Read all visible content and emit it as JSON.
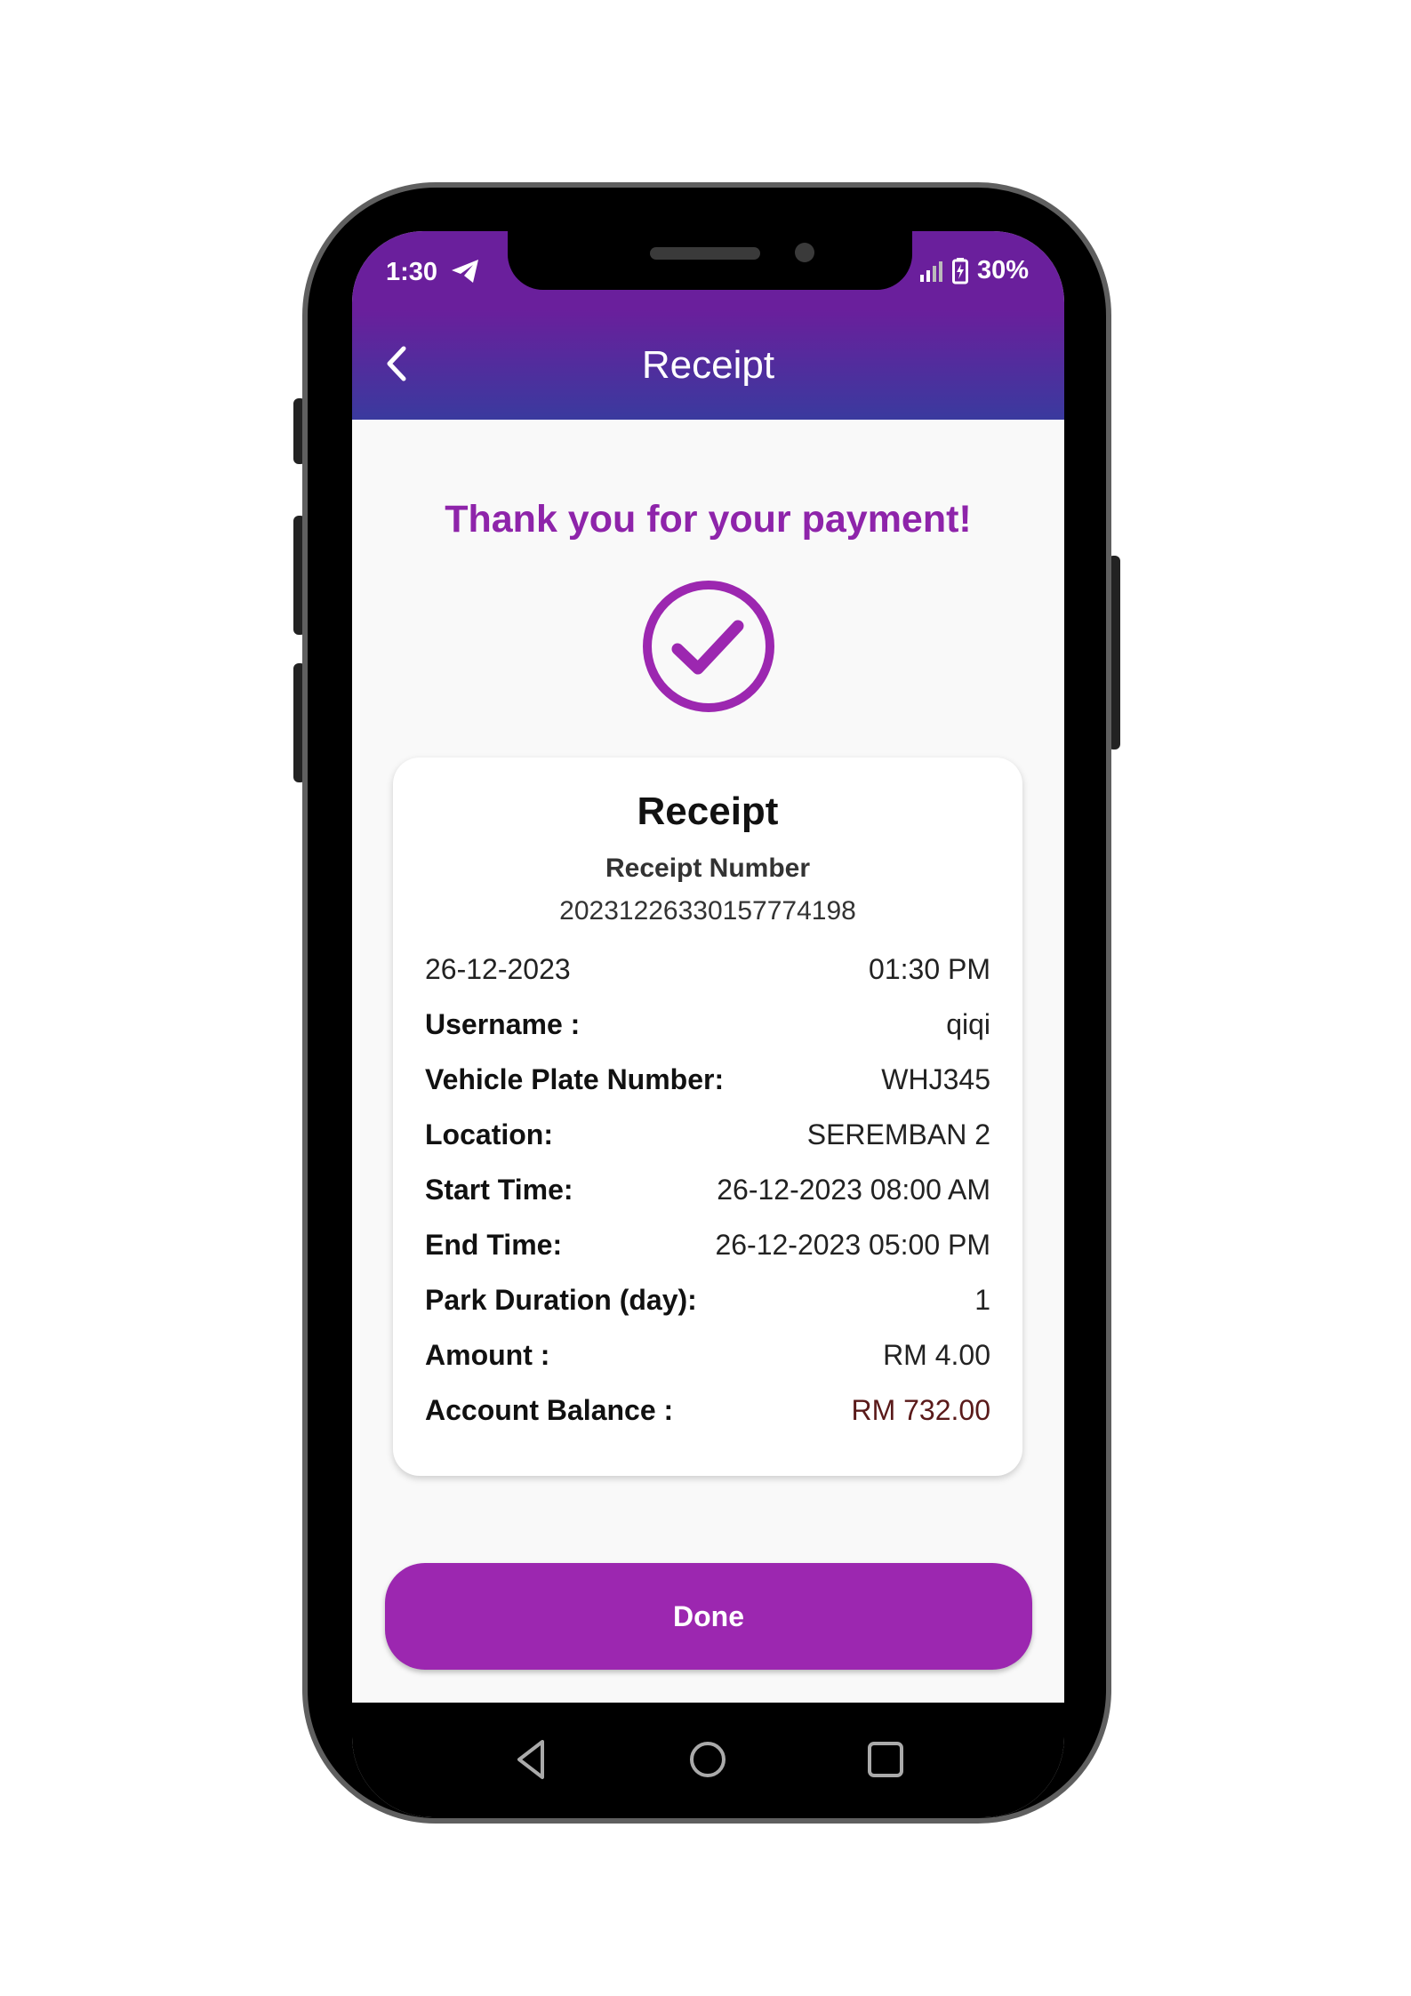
{
  "status_bar": {
    "time": "1:30",
    "battery": "30%",
    "icons": [
      "telegram-icon",
      "signal-icon",
      "battery-icon"
    ]
  },
  "app_bar": {
    "title": "Receipt",
    "back_icon": "back-arrow-icon"
  },
  "main": {
    "thanks_message": "Thank you for your payment!",
    "success_icon": "check-circle-icon"
  },
  "receipt": {
    "title": "Receipt",
    "number_label": "Receipt Number",
    "number": "20231226330157774198",
    "date": "26-12-2023",
    "time": "01:30 PM",
    "rows": [
      {
        "label": "Username :",
        "value": "qiqi"
      },
      {
        "label": "Vehicle Plate Number:",
        "value": "WHJ345"
      },
      {
        "label": "Location:",
        "value": "SEREMBAN 2"
      },
      {
        "label": "Start Time:",
        "value": "26-12-2023 08:00 AM"
      },
      {
        "label": "End Time:",
        "value": "26-12-2023 05:00 PM"
      },
      {
        "label": "Park Duration (day):",
        "value": "1"
      },
      {
        "label": "Amount :",
        "value": "RM 4.00"
      },
      {
        "label": "Account Balance :",
        "value": "RM 732.00"
      }
    ]
  },
  "done_button": {
    "label": "Done"
  },
  "colors": {
    "accent": "#9c27b0",
    "header": "#6a1f9c",
    "thanks": "#8e24aa"
  }
}
